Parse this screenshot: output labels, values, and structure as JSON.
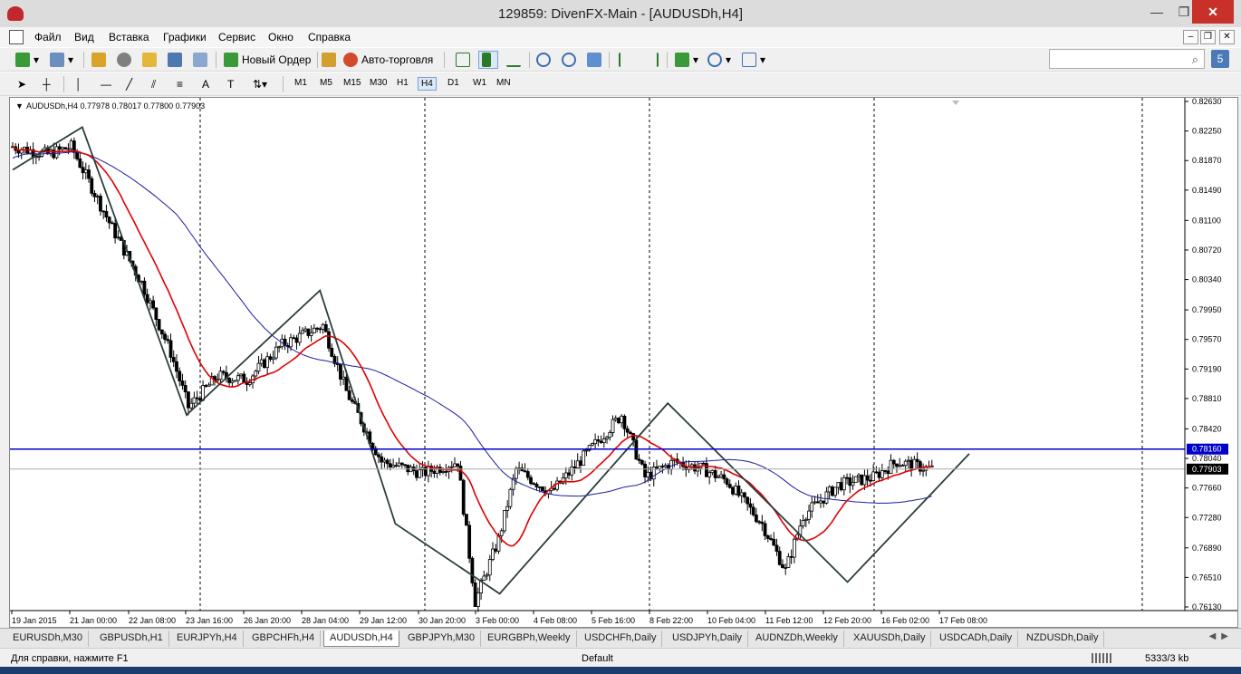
{
  "window": {
    "title": "129859: DivenFX-Main - [AUDUSDh,H4]"
  },
  "menu": [
    "Файл",
    "Вид",
    "Вставка",
    "Графики",
    "Сервис",
    "Окно",
    "Справка"
  ],
  "toolbar": {
    "new_order": "Новый Ордер",
    "auto_trading": "Авто-торговля",
    "badge": "5"
  },
  "timeframes": [
    "M1",
    "M5",
    "M15",
    "M30",
    "H1",
    "H4",
    "D1",
    "W1",
    "MN"
  ],
  "active_timeframe": "H4",
  "chart": {
    "header": "AUDUSDh,H4  0.77978 0.78017 0.77800 0.77903",
    "price_labels": [
      "0.82630",
      "0.82250",
      "0.81870",
      "0.81490",
      "0.81100",
      "0.80720",
      "0.80340",
      "0.79950",
      "0.79570",
      "0.79190",
      "0.78810",
      "0.78420",
      "0.78040",
      "0.77660",
      "0.77280",
      "0.76890",
      "0.76510",
      "0.76130"
    ],
    "hline_price": "0.78160",
    "current_price": "0.77903",
    "time_labels": [
      "19 Jan 2015",
      "21 Jan 00:00",
      "22 Jan 08:00",
      "23 Jan 16:00",
      "26 Jan 20:00",
      "28 Jan 04:00",
      "29 Jan 12:00",
      "30 Jan 20:00",
      "3 Feb 00:00",
      "4 Feb 08:00",
      "5 Feb 16:00",
      "8 Feb 22:00",
      "10 Feb 04:00",
      "11 Feb 12:00",
      "12 Feb 20:00",
      "16 Feb 02:00",
      "17 Feb 08:00"
    ],
    "colors": {
      "bull": "#ffffff",
      "bear": "#000000",
      "ma_fast": "#e00000",
      "ma_slow": "#1c1ca0",
      "zigzag": "#2c3e3e",
      "hline": "#0000cc"
    }
  },
  "tabs": [
    "EURUSDh,M30",
    "GBPUSDh,H1",
    "EURJPYh,H4",
    "GBPCHFh,H4",
    "AUDUSDh,H4",
    "GBPJPYh,M30",
    "EURGBPh,Weekly",
    "USDCHFh,Daily",
    "USDJPYh,Daily",
    "AUDNZDh,Weekly",
    "XAUUSDh,Daily",
    "USDCADh,Daily",
    "NZDUSDh,Daily"
  ],
  "active_tab": "AUDUSDh,H4",
  "status": {
    "help": "Для справки, нажмите F1",
    "profile": "Default",
    "traffic": "5333/3 kb"
  }
}
